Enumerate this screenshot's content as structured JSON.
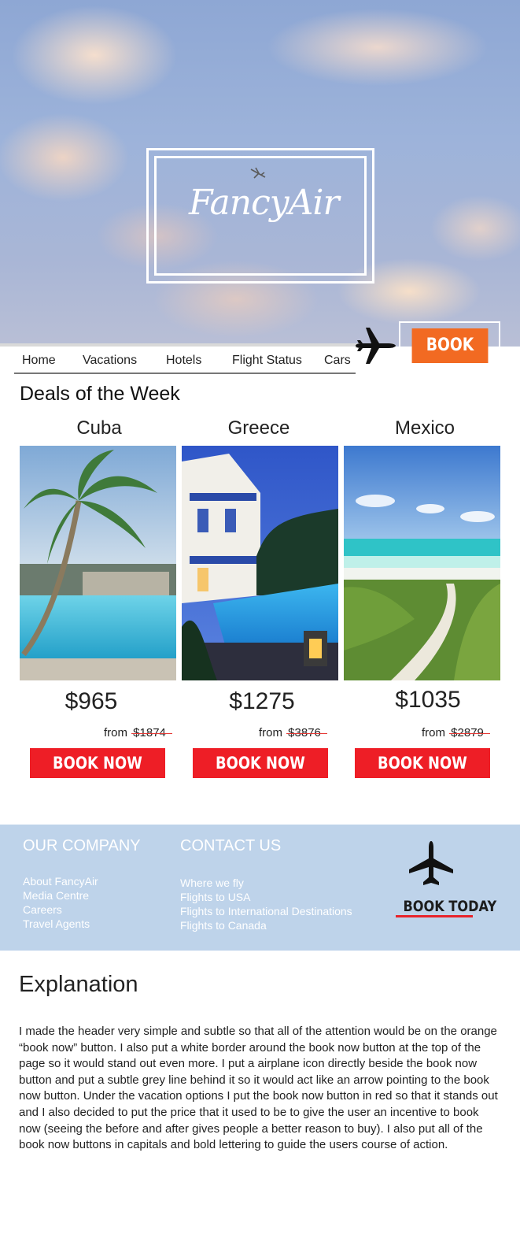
{
  "brand": {
    "logo_text": "FancyAir"
  },
  "nav": {
    "items": [
      {
        "label": "Home"
      },
      {
        "label": "Vacations"
      },
      {
        "label": "Hotels"
      },
      {
        "label": "Flight Status"
      },
      {
        "label": "Cars"
      }
    ]
  },
  "header": {
    "book_now_label": "BOOK NOW",
    "book_now_color": "#f26a22"
  },
  "deals": {
    "title": "Deals of the Week",
    "items": [
      {
        "name": "Cuba",
        "price": "$965",
        "from_label": "from",
        "old_price": "$1874",
        "button_label": "BOOK NOW",
        "photo": "palm-tree-pool-photo"
      },
      {
        "name": "Greece",
        "price": "$1275",
        "from_label": "from",
        "old_price": "$3876",
        "button_label": "BOOK NOW",
        "photo": "white-villa-pool-photo"
      },
      {
        "name": "Mexico",
        "price": "$1035",
        "from_label": "from",
        "old_price": "$2879",
        "button_label": "BOOK NOW",
        "photo": "beach-path-photo"
      }
    ],
    "button_color": "#ee1e26"
  },
  "footer": {
    "background": "#bed3ea",
    "company": {
      "heading": "OUR COMPANY",
      "links": [
        "About FancyAir",
        "Media Centre",
        "Careers",
        "Travel Agents"
      ]
    },
    "contact": {
      "heading": "CONTACT US",
      "links": [
        "Where we fly",
        "Flights to USA",
        "Flights to International Destinations",
        "Flights to Canada"
      ]
    },
    "book_today_label": "BOOK TODAY"
  },
  "explanation": {
    "title": "Explanation",
    "body": "I made the header very simple and subtle so that all of the attention would be on the orange “book now” button. I also put a white border around the book now button at the top of the page so it would stand out even more. I put a airplane icon directly beside the book now button and put a subtle grey line behind it so it would act like an arrow pointing to the book now button. Under the vacation options I put the book now button in red so that it stands out and I also decided to put the price that it used to be to give the user an incentive to book now (seeing the before and after gives people a better reason to buy). I also put all of the book now buttons in capitals and bold lettering to guide the users course of action."
  }
}
